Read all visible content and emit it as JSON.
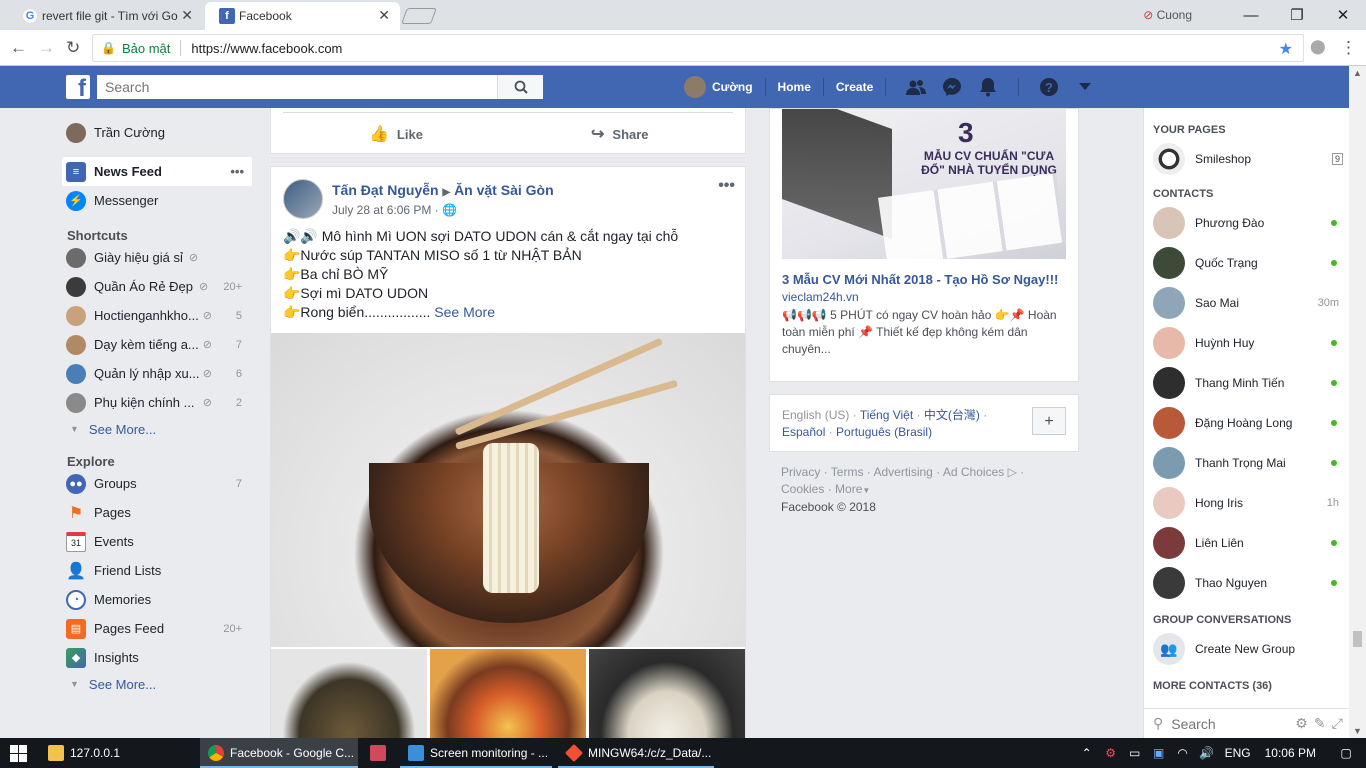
{
  "browser": {
    "tabs": [
      {
        "title": "revert file git - Tìm với Go",
        "favicon": "google-icon"
      },
      {
        "title": "Facebook",
        "favicon": "facebook-icon"
      }
    ],
    "user": "Cuong",
    "security_label": "Bảo mật",
    "url": "https://www.facebook.com"
  },
  "fb_header": {
    "search_placeholder": "Search",
    "profile_name": "Cường",
    "home": "Home",
    "create": "Create"
  },
  "left_nav": {
    "profile": "Trần Cường",
    "news_feed": "News Feed",
    "messenger": "Messenger",
    "shortcuts_title": "Shortcuts",
    "shortcuts": [
      {
        "label": "Giày hiệu giá sỉ",
        "count": ""
      },
      {
        "label": "Quần Áo Rẻ Đẹp",
        "count": "20+"
      },
      {
        "label": "Hoctienganhkho...",
        "count": "5"
      },
      {
        "label": "Dạy kèm tiếng a...",
        "count": "7"
      },
      {
        "label": "Quản lý nhập xu...",
        "count": "6"
      },
      {
        "label": "Phụ kiện chính ...",
        "count": "2"
      }
    ],
    "see_more": "See More...",
    "explore_title": "Explore",
    "explore": [
      {
        "label": "Groups",
        "count": "7"
      },
      {
        "label": "Pages",
        "count": ""
      },
      {
        "label": "Events",
        "count": ""
      },
      {
        "label": "Friend Lists",
        "count": ""
      },
      {
        "label": "Memories",
        "count": ""
      },
      {
        "label": "Pages Feed",
        "count": "20+"
      },
      {
        "label": "Insights",
        "count": ""
      }
    ],
    "see_more_2": "See More...",
    "events_day": "31"
  },
  "feed": {
    "like": "Like",
    "share": "Share",
    "post": {
      "author": "Tấn Đạt Nguyễn",
      "group": "Ăn vặt Sài Gòn",
      "time": "July 28 at 6:06 PM ·",
      "lines": [
        "🔊🔊 Mô hình Mì UON sợi DATO UDON cán & cắt ngay tại chỗ",
        "👉Nước súp TANTAN MISO số 1 từ NHẬT BẢN",
        "👉Ba chỉ BÒ MỸ",
        "👉Sợi mì DATO UDON",
        "👉Rong biển................."
      ],
      "see_more": "See More"
    }
  },
  "ad": {
    "number": "3",
    "headline": "MẪU CV CHUẨN \"CƯA ĐỔ\" NHÀ TUYỂN DỤNG",
    "title": "3 Mẫu CV Mới Nhất 2018 - Tạo Hồ Sơ Ngay!!!",
    "domain": "vieclam24h.vn",
    "body": "📢📢📢 5 PHÚT có ngay CV hoàn hảo 👉📌 Hoàn toàn miễn phí 📌 Thiết kế đẹp không kém dân chuyên..."
  },
  "languages": {
    "current": "English (US)",
    "links": [
      "Tiếng Việt",
      "中文(台灣)",
      "Español",
      "Português (Brasil)"
    ],
    "add": "+"
  },
  "footer": {
    "links": [
      "Privacy",
      "Terms",
      "Advertising",
      "Ad Choices",
      "Cookies",
      "More"
    ],
    "copyright": "Facebook © 2018"
  },
  "chat": {
    "your_pages": "YOUR PAGES",
    "page": {
      "name": "Smileshop",
      "badge": "9"
    },
    "contacts_title": "CONTACTS",
    "contacts": [
      {
        "name": "Phương Đào",
        "status": "online",
        "ago": ""
      },
      {
        "name": "Quốc Trạng",
        "status": "online",
        "ago": ""
      },
      {
        "name": "Sao Mai",
        "status": "idle",
        "ago": "30m"
      },
      {
        "name": "Huỳnh Huy",
        "status": "online",
        "ago": ""
      },
      {
        "name": "Thang Minh Tiến",
        "status": "online",
        "ago": ""
      },
      {
        "name": "Đặng Hoàng Long",
        "status": "online",
        "ago": ""
      },
      {
        "name": "Thanh Trọng Mai",
        "status": "online",
        "ago": ""
      },
      {
        "name": "Hong Iris",
        "status": "idle",
        "ago": "1h"
      },
      {
        "name": "Liên Liên",
        "status": "online",
        "ago": ""
      },
      {
        "name": "Thao Nguyen",
        "status": "online",
        "ago": ""
      }
    ],
    "group_title": "GROUP CONVERSATIONS",
    "create_group": "Create New Group",
    "more_contacts": "MORE CONTACTS (36)",
    "search_placeholder": "Search"
  },
  "taskbar": {
    "items": [
      "127.0.0.1",
      "Facebook - Google C...",
      "Screen monitoring - ...",
      "MINGW64:/c/z_Data/..."
    ],
    "lang": "ENG",
    "time": "10:06 PM"
  },
  "colors": {
    "fb_blue": "#4267b2",
    "link": "#365899",
    "online": "#42b72a"
  }
}
